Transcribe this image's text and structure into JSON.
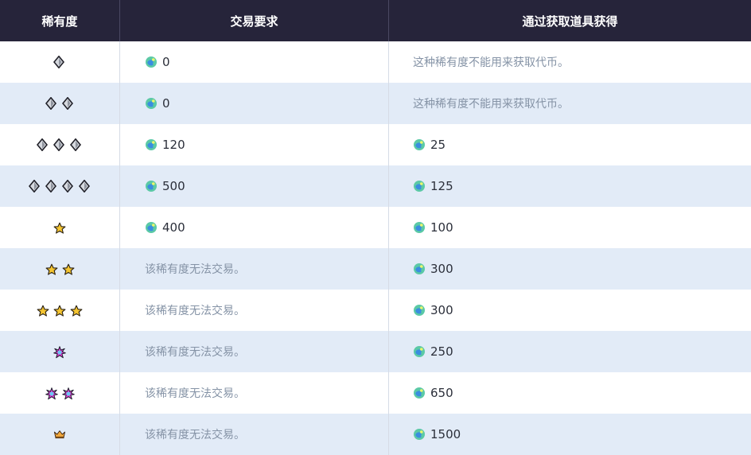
{
  "columns": [
    "稀有度",
    "交易要求",
    "通过获取道具获得"
  ],
  "colors": {
    "header_bg": "#26243a",
    "row_alt": "#e2ebf7",
    "note_text": "#8593a6"
  },
  "rows": [
    {
      "rarity": "diamond",
      "count": 1,
      "trade": "0",
      "trade_note": "",
      "obtain": "",
      "obtain_note": "这种稀有度不能用来获取代币。"
    },
    {
      "rarity": "diamond",
      "count": 2,
      "trade": "0",
      "trade_note": "",
      "obtain": "",
      "obtain_note": "这种稀有度不能用来获取代币。"
    },
    {
      "rarity": "diamond",
      "count": 3,
      "trade": "120",
      "trade_note": "",
      "obtain": "25",
      "obtain_note": ""
    },
    {
      "rarity": "diamond",
      "count": 4,
      "trade": "500",
      "trade_note": "",
      "obtain": "125",
      "obtain_note": ""
    },
    {
      "rarity": "star",
      "count": 1,
      "trade": "400",
      "trade_note": "",
      "obtain": "100",
      "obtain_note": ""
    },
    {
      "rarity": "star",
      "count": 2,
      "trade": "",
      "trade_note": "该稀有度无法交易。",
      "obtain": "300",
      "obtain_note": ""
    },
    {
      "rarity": "star",
      "count": 3,
      "trade": "",
      "trade_note": "该稀有度无法交易。",
      "obtain": "300",
      "obtain_note": ""
    },
    {
      "rarity": "shiny",
      "count": 1,
      "trade": "",
      "trade_note": "该稀有度无法交易。",
      "obtain": "250",
      "obtain_note": ""
    },
    {
      "rarity": "shiny",
      "count": 2,
      "trade": "",
      "trade_note": "该稀有度无法交易。",
      "obtain": "650",
      "obtain_note": ""
    },
    {
      "rarity": "crown",
      "count": 1,
      "trade": "",
      "trade_note": "该稀有度无法交易。",
      "obtain": "1500",
      "obtain_note": ""
    }
  ]
}
